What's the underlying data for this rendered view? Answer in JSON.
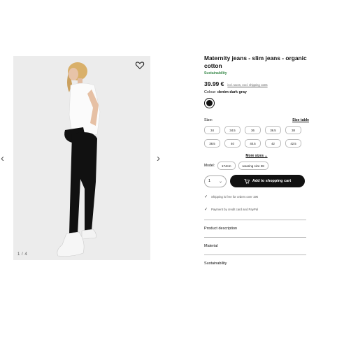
{
  "gallery": {
    "prev_arrow": "‹",
    "next_arrow": "›",
    "counter": "1 / 4"
  },
  "product": {
    "title": "Maternity jeans - slim jeans - organic cotton",
    "sustainability": "Sustainability",
    "price": "39.99 €",
    "price_note": "incl. taxes, excl. shipping costs",
    "colour_label": "Colour:",
    "colour_value": "denim-dark gray",
    "colour_hex": "#111111"
  },
  "size": {
    "label": "Size:",
    "table_link": "Size table",
    "options": [
      "34",
      "34.5",
      "36",
      "36.5",
      "38",
      "38.5",
      "40",
      "40.5",
      "42",
      "42.5"
    ],
    "more": "More sizes"
  },
  "model": {
    "label": "Model:",
    "height": "174cm",
    "wearing": "wearing size 38"
  },
  "cart": {
    "quantity": "1",
    "button": "Add to shopping cart"
  },
  "info": {
    "shipping": "Shipping is free for orders over 19€",
    "payment": "Payment by credit card and PayPal"
  },
  "accordion": [
    "Product description",
    "Material",
    "Sustainability"
  ],
  "colors": {
    "accent": "#111111",
    "sustainability": "#3a8a4b"
  },
  "icons": [
    "heart-icon",
    "chevron-left-icon",
    "chevron-right-icon",
    "chevron-down-icon",
    "cart-icon",
    "checkmark-icon"
  ]
}
